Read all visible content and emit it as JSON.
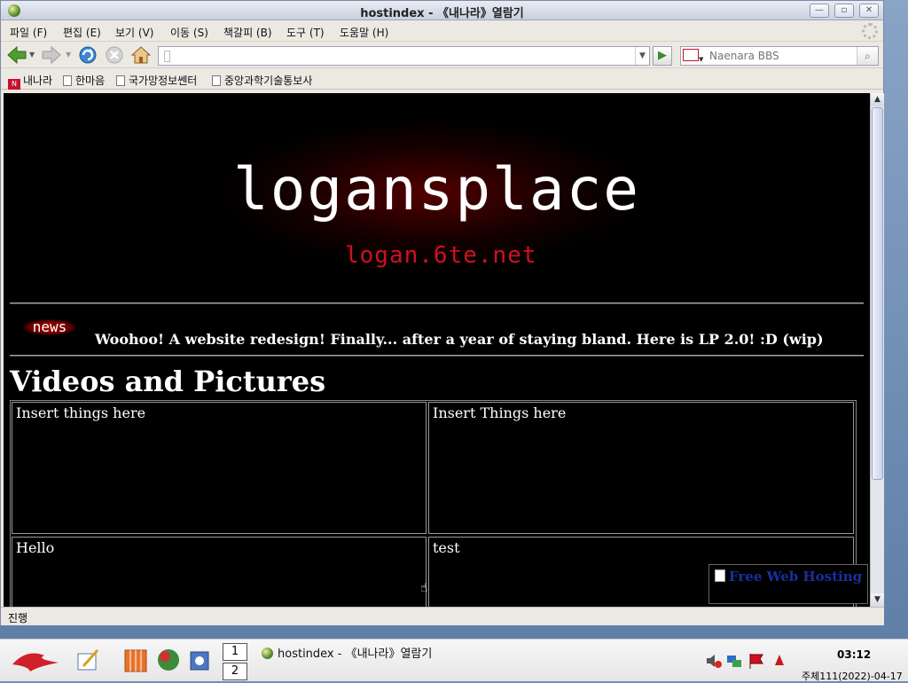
{
  "window": {
    "title": "hostindex - 《내나라》열람기"
  },
  "menu": {
    "items": [
      "파일 (F)",
      "편집 (E)",
      "보기 (V)",
      "이동 (S)",
      "책갈피 (B)",
      "도구 (T)",
      "도움말 (H)"
    ]
  },
  "navbar": {
    "url_value": "",
    "search_placeholder": "Naenara BBS"
  },
  "bookmarks": {
    "items": [
      "내나라",
      "한마음",
      "국가망정보쎈터",
      "중앙과학기술통보사"
    ]
  },
  "page": {
    "logo": "logansplace",
    "logo_sub": "logan.6te.net",
    "news_tag": "news",
    "news_text": "Woohoo! A website redesign! Finally... after a year of staying bland. Here is LP 2.0! :D (wip)",
    "heading": "Videos and Pictures",
    "cells": [
      "Insert things here",
      "Insert Things here",
      "Hello",
      "test"
    ],
    "hosting_link": "Free Web Hosting"
  },
  "status": {
    "text": "진행"
  },
  "taskbar": {
    "pager": [
      "1",
      "2"
    ],
    "task_title": "hostindex - 《내나라》열람기",
    "clock": "03:12",
    "date": "주체111(2022)-04-17"
  },
  "colors": {
    "page_bg": "#000000",
    "accent_red": "#d01020",
    "link": "#1a2fa0"
  }
}
